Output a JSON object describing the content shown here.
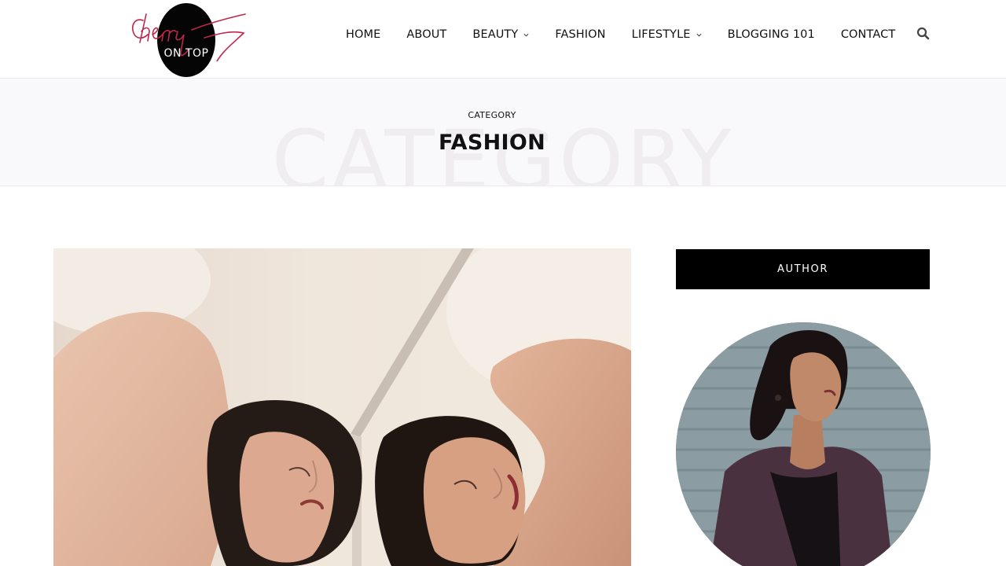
{
  "logo": {
    "script_text": "Cherry",
    "sub_text": "ON TOP"
  },
  "nav": {
    "items": [
      {
        "label": "HOME",
        "dropdown": false
      },
      {
        "label": "ABOUT",
        "dropdown": false
      },
      {
        "label": "BEAUTY",
        "dropdown": true
      },
      {
        "label": "FASHION",
        "dropdown": false
      },
      {
        "label": "LIFESTYLE",
        "dropdown": true
      },
      {
        "label": "BLOGGING 101",
        "dropdown": false
      },
      {
        "label": "CONTACT",
        "dropdown": false
      }
    ],
    "search_icon": "search-icon"
  },
  "banner": {
    "ghost_text": "CATEGORY",
    "kicker": "CATEGORY",
    "title": "FASHION"
  },
  "sidebar": {
    "author_heading": "AUTHOR"
  },
  "colors": {
    "logo_script": "#c0264a",
    "banner_bg": "#f9f8fa",
    "dark": "#000000"
  }
}
